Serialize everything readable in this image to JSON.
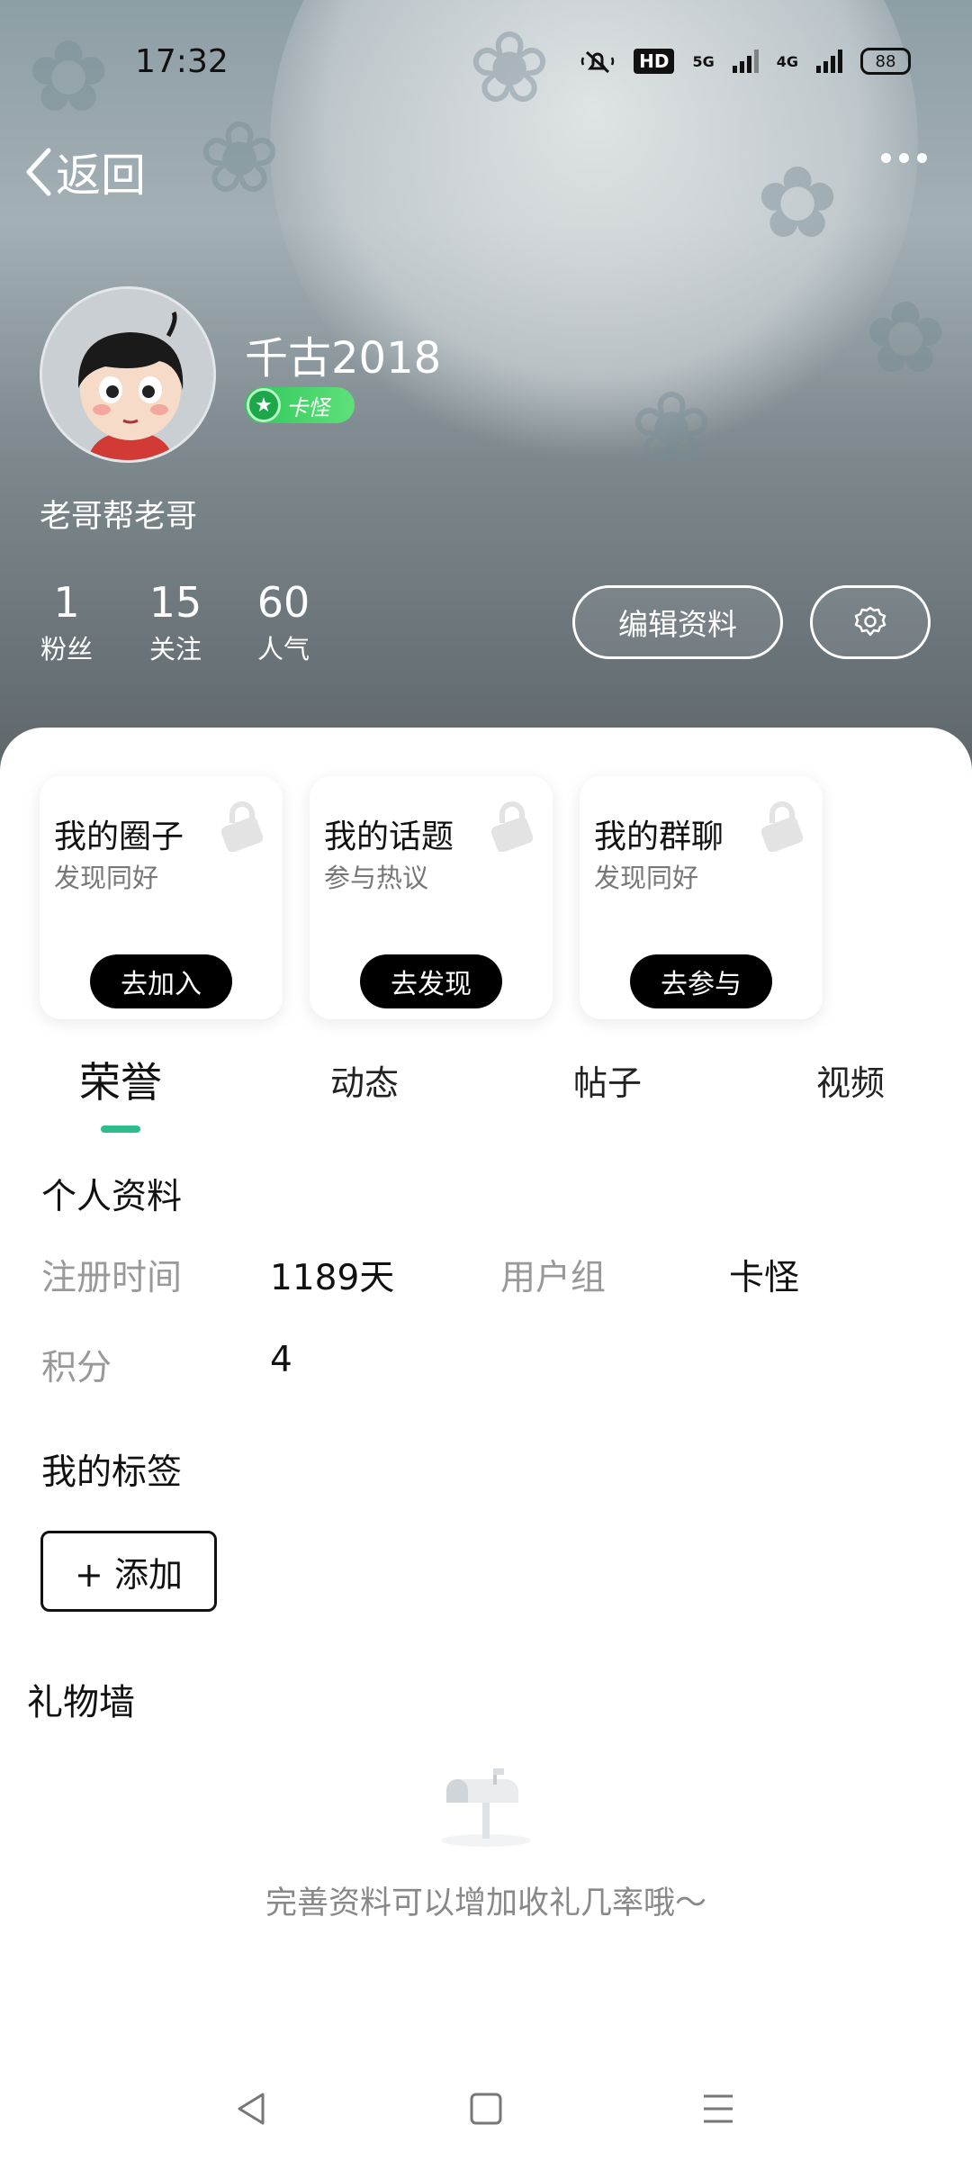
{
  "status_bar": {
    "time": "17:32",
    "hd_label": "HD",
    "net1": "5G",
    "net2": "4G",
    "battery": "88"
  },
  "nav": {
    "back_label": "返回",
    "more_icon": "more-horizontal-icon"
  },
  "profile": {
    "username": "千古2018",
    "level": "卡怪",
    "bio": "老哥帮老哥",
    "stats": [
      {
        "value": "1",
        "label": "粉丝"
      },
      {
        "value": "15",
        "label": "关注"
      },
      {
        "value": "60",
        "label": "人气"
      }
    ],
    "edit_label": "编辑资料",
    "settings_icon": "gear-icon"
  },
  "features": [
    {
      "title": "我的圈子",
      "subtitle": "发现同好",
      "button": "去加入"
    },
    {
      "title": "我的话题",
      "subtitle": "参与热议",
      "button": "去发现"
    },
    {
      "title": "我的群聊",
      "subtitle": "发现同好",
      "button": "去参与"
    }
  ],
  "tabs": [
    "荣誉",
    "动态",
    "帖子",
    "视频"
  ],
  "active_tab": "荣誉",
  "personal_info": {
    "title": "个人资料",
    "reg_time_label": "注册时间",
    "reg_time_value": "1189天",
    "user_group_label": "用户组",
    "user_group_value": "卡怪",
    "points_label": "积分",
    "points_value": "4"
  },
  "tags": {
    "title": "我的标签",
    "add_label": "+ 添加"
  },
  "gift_wall": {
    "title": "礼物墙",
    "empty_tip": "完善资料可以增加收礼几率哦～"
  },
  "colors": {
    "accent": "#2bbd8c",
    "level_badge": "#2ec85a"
  }
}
